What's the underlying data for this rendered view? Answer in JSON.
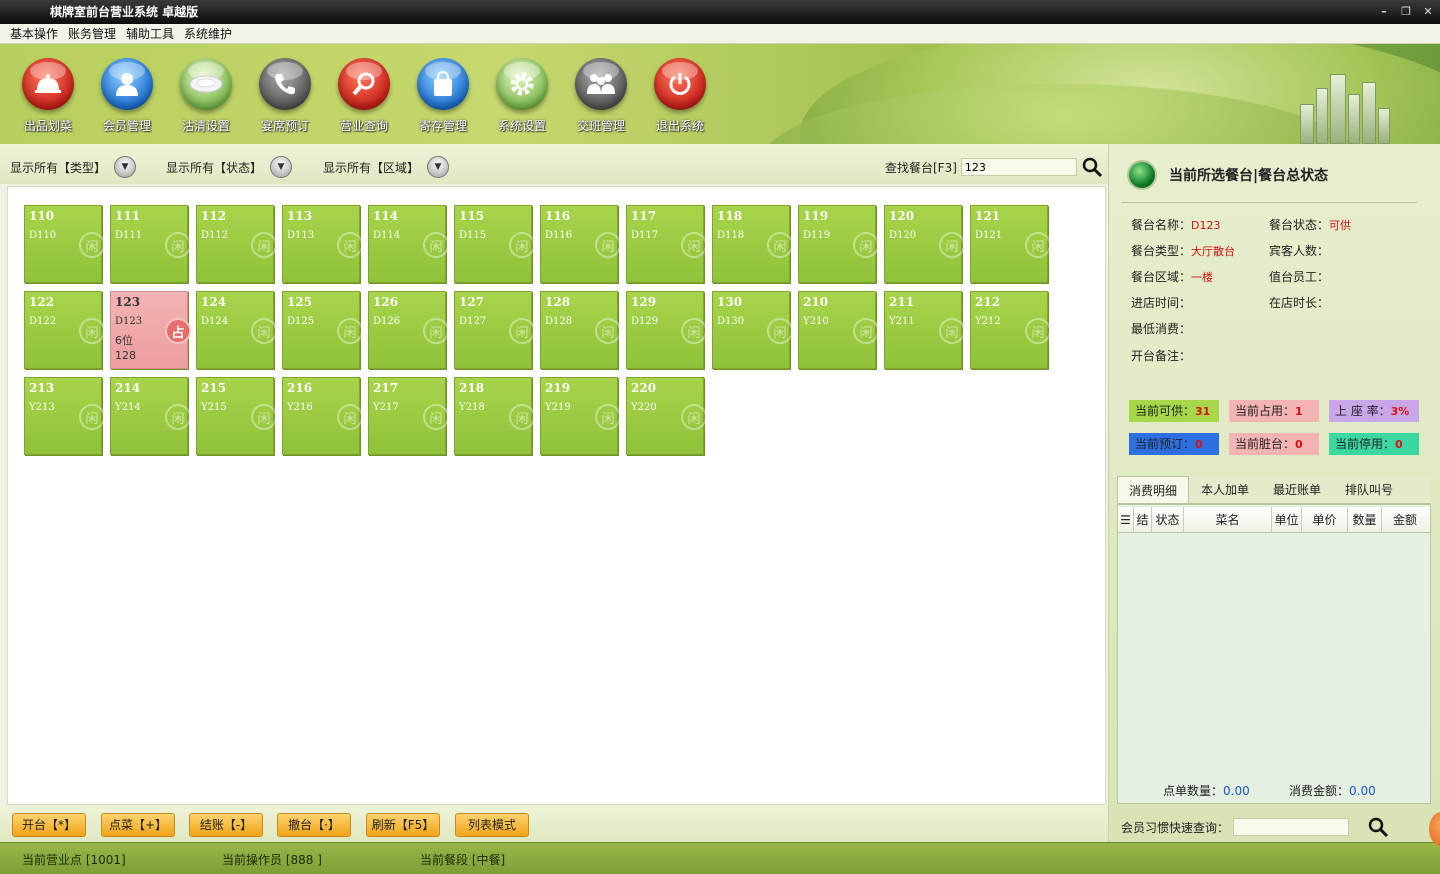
{
  "window": {
    "title": "棋牌室前台营业系统 卓越版",
    "min": "–",
    "restore": "❐",
    "close": "✕"
  },
  "menu": [
    "基本操作",
    "账务管理",
    "辅助工具",
    "系统维护"
  ],
  "toolbar": [
    {
      "label": "出品划菜",
      "icon": "service-bell-icon",
      "color": "red"
    },
    {
      "label": "会员管理",
      "icon": "member-user-icon",
      "color": "blue"
    },
    {
      "label": "沽清设置",
      "icon": "plate-icon",
      "color": "green"
    },
    {
      "label": "宴席预订",
      "icon": "phone-icon",
      "color": "gray"
    },
    {
      "label": "营业查询",
      "icon": "magnifier-icon",
      "color": "red"
    },
    {
      "label": "寄存管理",
      "icon": "shopping-bag-icon",
      "color": "blue"
    },
    {
      "label": "系统设置",
      "icon": "gear-icon",
      "color": "green"
    },
    {
      "label": "交班管理",
      "icon": "handover-people-icon",
      "color": "gray"
    },
    {
      "label": "退出系统",
      "icon": "power-icon",
      "color": "red"
    }
  ],
  "filters": {
    "type": "显示所有【类型】",
    "status": "显示所有【状态】",
    "area": "显示所有【区域】",
    "search_label": "查找餐台[F3]",
    "search_value": "123"
  },
  "tables": [
    {
      "num": "110",
      "code": "D110"
    },
    {
      "num": "111",
      "code": "D111"
    },
    {
      "num": "112",
      "code": "D112"
    },
    {
      "num": "113",
      "code": "D113"
    },
    {
      "num": "114",
      "code": "D114"
    },
    {
      "num": "115",
      "code": "D115"
    },
    {
      "num": "116",
      "code": "D116"
    },
    {
      "num": "117",
      "code": "D117"
    },
    {
      "num": "118",
      "code": "D118"
    },
    {
      "num": "119",
      "code": "D119"
    },
    {
      "num": "120",
      "code": "D120"
    },
    {
      "num": "121",
      "code": "D121"
    },
    {
      "num": "122",
      "code": "D122"
    },
    {
      "num": "123",
      "code": "D123",
      "occupied": true,
      "seats": "6位",
      "amount": "128",
      "badge": "占"
    },
    {
      "num": "124",
      "code": "D124"
    },
    {
      "num": "125",
      "code": "D125"
    },
    {
      "num": "126",
      "code": "D126"
    },
    {
      "num": "127",
      "code": "D127"
    },
    {
      "num": "128",
      "code": "D128"
    },
    {
      "num": "129",
      "code": "D129"
    },
    {
      "num": "130",
      "code": "D130"
    },
    {
      "num": "210",
      "code": "Y210"
    },
    {
      "num": "211",
      "code": "Y211"
    },
    {
      "num": "212",
      "code": "Y212"
    },
    {
      "num": "213",
      "code": "Y213"
    },
    {
      "num": "214",
      "code": "Y214"
    },
    {
      "num": "215",
      "code": "Y215"
    },
    {
      "num": "216",
      "code": "Y216"
    },
    {
      "num": "217",
      "code": "Y217"
    },
    {
      "num": "218",
      "code": "Y218"
    },
    {
      "num": "219",
      "code": "Y219"
    },
    {
      "num": "220",
      "code": "Y220"
    }
  ],
  "tile_logo": "闲",
  "buttons": [
    "开台【*】",
    "点菜【+】",
    "结账【-】",
    "撤台【·】",
    "刷新【F5】",
    "列表模式"
  ],
  "status": {
    "point": "当前营业点 [1001]",
    "operator": "当前操作员 [888 ]",
    "meal": "当前餐段 [中餐]"
  },
  "panel": {
    "title": "当前所选餐台|餐台总状态",
    "fields": {
      "name_label": "餐台名称：",
      "name_value": "D123",
      "state_label": "餐台状态：",
      "state_value": "可供",
      "type_label": "餐台类型：",
      "type_value": "大厅散台",
      "guests_label": "宾客人数：",
      "area_label": "餐台区域：",
      "area_value": "一楼",
      "staff_label": "值台员工：",
      "entry_label": "进店时间：",
      "duration_label": "在店时长：",
      "min_label": "最低消费：",
      "note_label": "开台备注："
    },
    "stats": {
      "available_label": "当前可供：",
      "available": "31",
      "occupied_label": "当前占用：",
      "occupied": "1",
      "rate_label": "上 座 率：",
      "rate": "3%",
      "reserved_label": "当前预订：",
      "reserved": "0",
      "dirty_label": "当前脏台：",
      "dirty": "0",
      "stopped_label": "当前停用：",
      "stopped": "0"
    },
    "colors": {
      "available": "#a6d84a",
      "occupied": "#f4b4b4",
      "rate": "#c8a6e8",
      "reserved": "#2d6fe0",
      "dirty": "#f4b4b4",
      "stopped": "#3ad8a0"
    },
    "tabs": [
      "消费明细",
      "本人加单",
      "最近账单",
      "排队叫号"
    ],
    "columns": [
      "☰",
      "结",
      "状态",
      "菜名",
      "单位",
      "单价",
      "数量",
      "金额"
    ],
    "footer": {
      "count_label": "点单数量：",
      "count": "0.00",
      "amount_label": "消费金额：",
      "amount": "0.00"
    },
    "member_label": "会员习惯快速查询："
  }
}
